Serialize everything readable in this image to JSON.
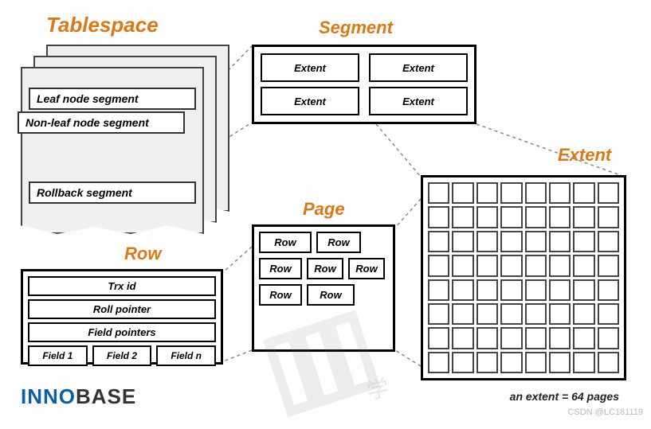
{
  "titles": {
    "tablespace": "Tablespace",
    "segment": "Segment",
    "extent": "Extent",
    "page": "Page",
    "row": "Row"
  },
  "tablespace": {
    "leaf": "Leaf node segment",
    "nonleaf": "Non-leaf node segment",
    "rollback": "Rollback segment"
  },
  "segment": {
    "cells": [
      "Extent",
      "Extent",
      "Extent",
      "Extent"
    ]
  },
  "page": {
    "rows": [
      "Row",
      "Row",
      "Row",
      "Row",
      "Row",
      "Row",
      "Row"
    ]
  },
  "row": {
    "trx": "Trx id",
    "roll": "Roll pointer",
    "fieldptrs": "Field pointers",
    "fields": [
      "Field 1",
      "Field 2",
      "Field n"
    ]
  },
  "extent": {
    "grid_size": 64
  },
  "caption": "an extent = 64 pages",
  "logo": {
    "part1": "INNO",
    "part2": "BASE"
  },
  "credit": "CSDN @LC181119"
}
